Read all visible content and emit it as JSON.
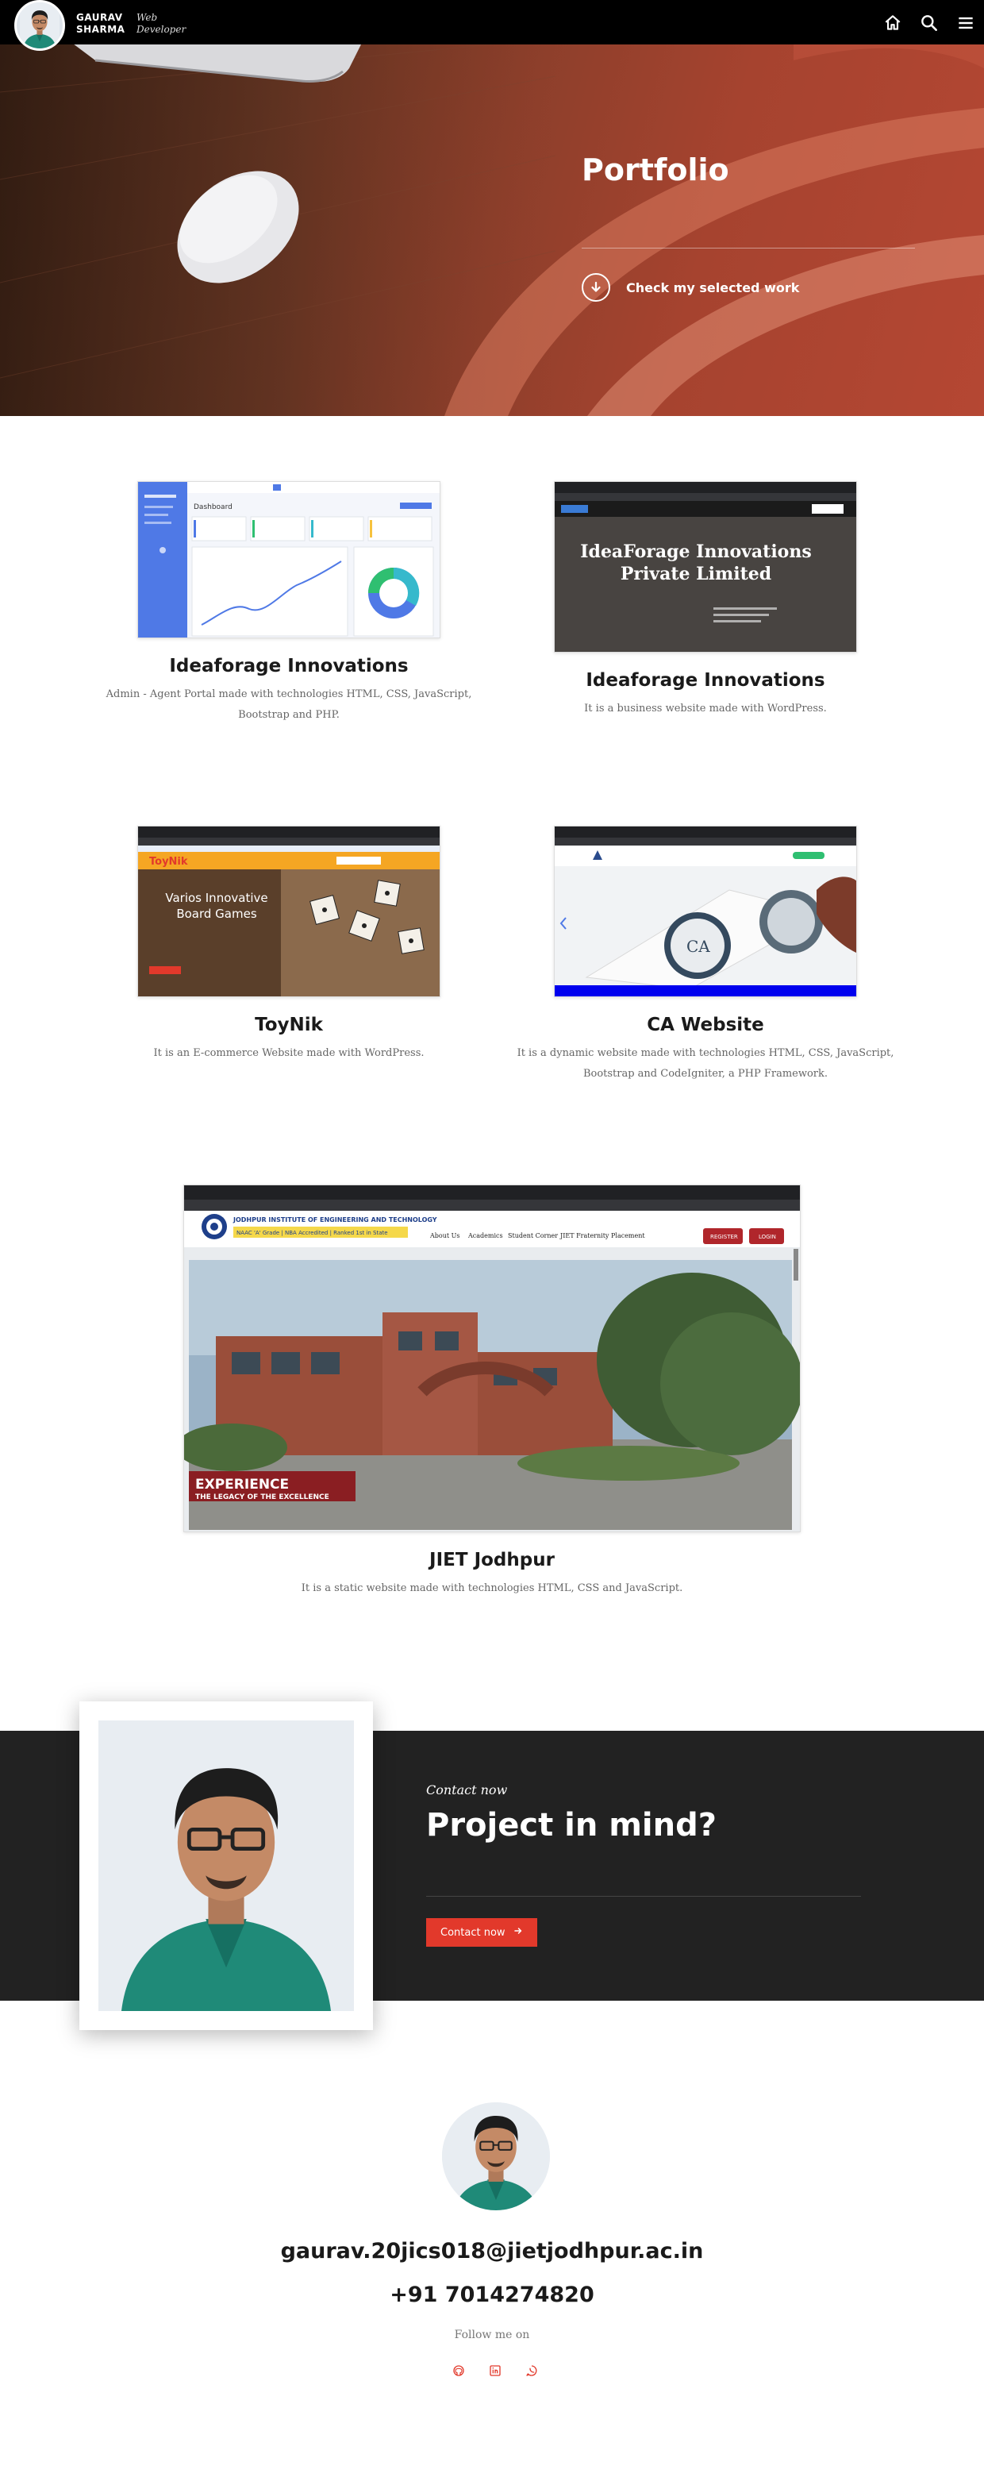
{
  "header": {
    "name_line1": "GAURAV",
    "name_line2": "SHARMA",
    "role_line1": "Web",
    "role_line2": "Developer",
    "icons": [
      "home-icon",
      "search-icon",
      "menu-icon"
    ]
  },
  "hero": {
    "title": "Portfolio",
    "cta_label": "Check my selected work"
  },
  "projects": [
    {
      "title": "Ideaforage Innovations",
      "description": "Admin - Agent Portal made with technologies HTML, CSS, JavaScript, Bootstrap and PHP.",
      "thumb_text": [
        "Dashboard"
      ]
    },
    {
      "title": "Ideaforage Innovations",
      "description": "It is a business website made with WordPress.",
      "thumb_text": [
        "IdeaForage Innovations Private Limited"
      ]
    },
    {
      "title": "ToyNik",
      "description": "It is an E-commerce Website made with WordPress.",
      "thumb_text": [
        "ToyNik",
        "Varios Innovative Board Games"
      ]
    },
    {
      "title": "CA Website",
      "description": "It is a dynamic website made with technologies HTML, CSS, JavaScript, Bootstrap and CodeIgniter, a PHP Framework.",
      "thumb_text": [
        "CA"
      ]
    },
    {
      "title": "JIET Jodhpur",
      "description": "It is a static website made with technologies HTML, CSS and JavaScript.",
      "thumb_text": [
        "JODHPUR INSTITUTE OF ENGINEERING AND TECHNOLOGY",
        "NAAC 'A' Grade | NBA Accredited | Ranked 1st in State",
        "About Us",
        "Academics",
        "Student Corner",
        "JIET Fraternity",
        "Placement",
        "REGISTER",
        "LOGIN",
        "EXPERIENCE",
        "THE LEGACY OF THE EXCELLENCE"
      ]
    }
  ],
  "contact": {
    "kicker": "Contact now",
    "title": "Project in mind?",
    "button_label": "Contact now"
  },
  "footer": {
    "email": "gaurav.20jics018@jietjodhpur.ac.in",
    "phone": "+91 7014274820",
    "follow_label": "Follow me on",
    "social_icons": [
      "github-icon",
      "linkedin-icon",
      "whatsapp-icon"
    ]
  },
  "colors": {
    "accent": "#e2392b",
    "dark_band": "#222222",
    "header_bg": "#000000",
    "hero_red": "#b54733"
  }
}
